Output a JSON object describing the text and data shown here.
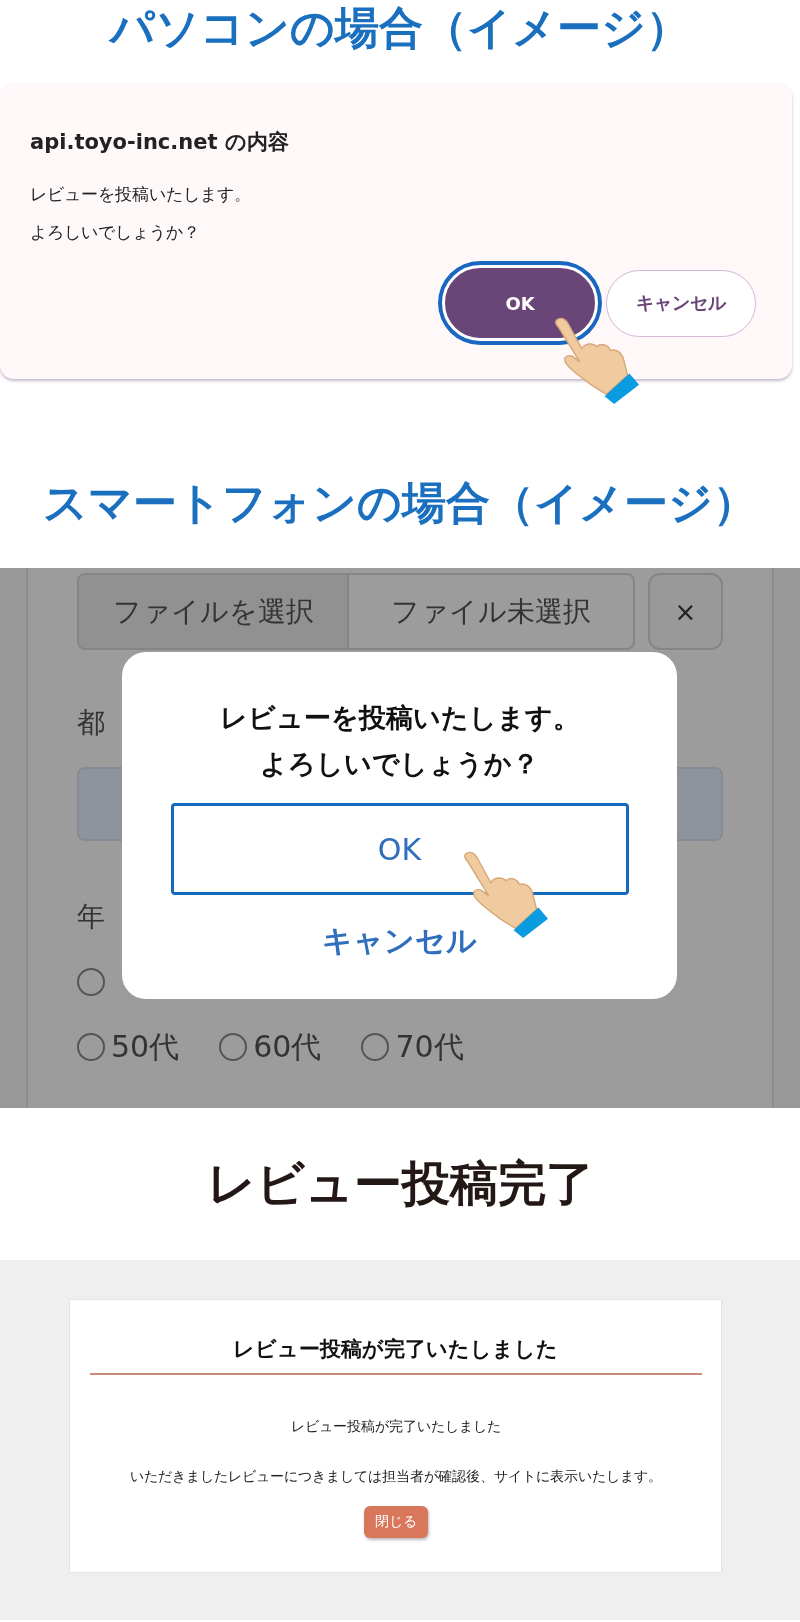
{
  "pc_section": {
    "heading": "パソコンの場合（イメージ）",
    "dialog": {
      "title": "api.toyo-inc.net の内容",
      "message": [
        "レビューを投稿いたします。",
        "よろしいでしょうか？"
      ],
      "buttons": [
        {
          "label": "OK",
          "focused": true
        },
        {
          "label": "キャンセル",
          "focused": false
        }
      ]
    }
  },
  "smartphone_section": {
    "heading": "スマートフォンの場合（イメージ）",
    "page": {
      "file_input": {
        "button": "ファイルを選択",
        "status": "ファイル未選択",
        "clear": "×"
      },
      "prefecture_label": "都",
      "age_label": "年",
      "age_option_rows": [
        {
          "options": [
            {
              "selected": false
            }
          ]
        },
        {
          "options": [
            {
              "label": "50代",
              "selected": false
            },
            {
              "label": "60代",
              "selected": false
            },
            {
              "label": "70代",
              "selected": false
            }
          ]
        }
      ]
    },
    "dialog": {
      "message": [
        "レビューを投稿いたします。",
        "よろしいでしょうか？"
      ],
      "buttons": [
        {
          "label": "OK",
          "focused": true
        },
        {
          "label": "キャンセル",
          "focused": false
        }
      ]
    }
  },
  "completion_section": {
    "heading": "レビュー投稿完了",
    "card": {
      "title": "レビュー投稿が完了いたしました",
      "paragraphs": [
        "レビュー投稿が完了いたしました",
        "いただきましたレビューにつきましては担当者が確認後、サイトに表示いたします。"
      ],
      "close_button": "閉じる"
    }
  }
}
